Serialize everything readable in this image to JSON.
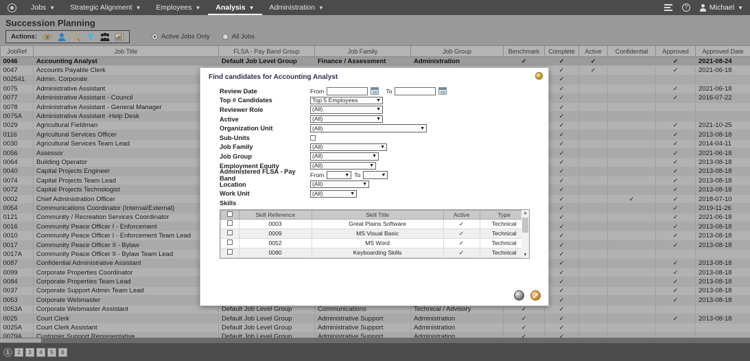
{
  "topnav": {
    "logo": "app-logo",
    "items": [
      {
        "label": "Jobs",
        "active": false
      },
      {
        "label": "Strategic Alignment",
        "active": false
      },
      {
        "label": "Employees",
        "active": false
      },
      {
        "label": "Analysis",
        "active": true
      },
      {
        "label": "Administration",
        "active": false
      }
    ],
    "user": "Michael"
  },
  "page": {
    "title": "Succession Planning",
    "actions_label": "Actions:",
    "action_icons": [
      "eye-icon",
      "person-icon",
      "magnifier-icon",
      "funnel-icon",
      "group-icon",
      "chart-icon"
    ],
    "radios": [
      {
        "label": "Active Jobs Only",
        "selected": true
      },
      {
        "label": "All Jobs",
        "selected": false
      }
    ]
  },
  "grid": {
    "columns": [
      "JobRef",
      "Job Title",
      "FLSA - Pay Band Group",
      "Job Family",
      "Job Group",
      "Benchmark",
      "Complete",
      "Active",
      "Confidential",
      "Approved",
      "Approved Date"
    ],
    "rows": [
      {
        "ref": "0046",
        "title": "Accounting Analyst",
        "flsa": "Default Job Level Group",
        "family": "Finance / Assessment",
        "group": "Administration",
        "benchmark": true,
        "complete": true,
        "active": true,
        "confidential": false,
        "approved": true,
        "date": "2021-08-24",
        "selected": true
      },
      {
        "ref": "0047",
        "title": "Accounts Payable Clerk",
        "flsa": "",
        "family": "",
        "group": "",
        "benchmark": true,
        "complete": true,
        "active": true,
        "confidential": false,
        "approved": true,
        "date": "2021-06-18"
      },
      {
        "ref": "002541",
        "title": "Admin. Corporate",
        "flsa": "",
        "family": "",
        "group": "",
        "benchmark": false,
        "complete": true,
        "active": false,
        "confidential": false,
        "approved": false,
        "date": ""
      },
      {
        "ref": "0075",
        "title": "Administrative Assistant",
        "flsa": "",
        "family": "",
        "group": "",
        "benchmark": true,
        "complete": true,
        "active": false,
        "confidential": false,
        "approved": true,
        "date": "2021-06-18"
      },
      {
        "ref": "0077",
        "title": "Administrative Assistant - Council",
        "flsa": "",
        "family": "",
        "group": "",
        "benchmark": true,
        "complete": true,
        "active": false,
        "confidential": false,
        "approved": true,
        "date": "2016-07-22"
      },
      {
        "ref": "0078",
        "title": "Administrative Assistant - General Manager",
        "flsa": "",
        "family": "",
        "group": "",
        "benchmark": true,
        "complete": true,
        "active": false,
        "confidential": false,
        "approved": false,
        "date": ""
      },
      {
        "ref": "0075A",
        "title": "Administrative Assistant -Help Desk",
        "flsa": "",
        "family": "",
        "group": "",
        "benchmark": true,
        "complete": true,
        "active": false,
        "confidential": false,
        "approved": false,
        "date": ""
      },
      {
        "ref": "0029",
        "title": "Agricultural Fieldman",
        "flsa": "",
        "family": "",
        "group": "",
        "benchmark": true,
        "complete": true,
        "active": false,
        "confidential": false,
        "approved": true,
        "date": "2021-10-25"
      },
      {
        "ref": "0116",
        "title": "Agricultural Services Officer",
        "flsa": "",
        "family": "",
        "group": "",
        "benchmark": true,
        "complete": true,
        "active": false,
        "confidential": false,
        "approved": true,
        "date": "2013-08-18"
      },
      {
        "ref": "0030",
        "title": "Agricultural Services Team Lead",
        "flsa": "",
        "family": "",
        "group": "",
        "benchmark": true,
        "complete": true,
        "active": false,
        "confidential": false,
        "approved": true,
        "date": "2014-04-11"
      },
      {
        "ref": "0056",
        "title": "Assessor",
        "flsa": "",
        "family": "",
        "group": "",
        "benchmark": true,
        "complete": true,
        "active": false,
        "confidential": false,
        "approved": true,
        "date": "2021-06-18"
      },
      {
        "ref": "0064",
        "title": "Building Operator",
        "flsa": "",
        "family": "",
        "group": "",
        "benchmark": true,
        "complete": true,
        "active": false,
        "confidential": false,
        "approved": true,
        "date": "2013-08-18"
      },
      {
        "ref": "0040",
        "title": "Capital Projects Engineer",
        "flsa": "",
        "family": "",
        "group": "",
        "benchmark": true,
        "complete": true,
        "active": false,
        "confidential": false,
        "approved": true,
        "date": "2013-08-18"
      },
      {
        "ref": "0074",
        "title": "Capital Projects Team Lead",
        "flsa": "",
        "family": "",
        "group": "",
        "benchmark": true,
        "complete": true,
        "active": false,
        "confidential": false,
        "approved": true,
        "date": "2013-08-18"
      },
      {
        "ref": "0072",
        "title": "Capital Projects Technologist",
        "flsa": "",
        "family": "",
        "group": "",
        "benchmark": true,
        "complete": true,
        "active": false,
        "confidential": false,
        "approved": true,
        "date": "2013-08-18"
      },
      {
        "ref": "0002",
        "title": "Chief Administration Officer",
        "flsa": "",
        "family": "",
        "group": "",
        "benchmark": true,
        "complete": true,
        "active": false,
        "confidential": true,
        "approved": true,
        "date": "2018-07-10"
      },
      {
        "ref": "0054",
        "title": "Communications Coordinator (Internal/External)",
        "flsa": "",
        "family": "",
        "group": "",
        "benchmark": true,
        "complete": true,
        "active": false,
        "confidential": false,
        "approved": true,
        "date": "2019-11-26"
      },
      {
        "ref": "0121",
        "title": "Community / Recreation Services Coordinator",
        "flsa": "",
        "family": "",
        "group": "",
        "benchmark": true,
        "complete": true,
        "active": false,
        "confidential": false,
        "approved": true,
        "date": "2021-06-18"
      },
      {
        "ref": "0016",
        "title": "Community Peace Officer I - Enforcement",
        "flsa": "",
        "family": "",
        "group": "",
        "benchmark": true,
        "complete": true,
        "active": false,
        "confidential": false,
        "approved": true,
        "date": "2013-08-18"
      },
      {
        "ref": "0010",
        "title": "Community Peace Officer I - Enforcement Team Lead",
        "flsa": "",
        "family": "",
        "group": "",
        "benchmark": true,
        "complete": true,
        "active": false,
        "confidential": false,
        "approved": true,
        "date": "2013-08-18"
      },
      {
        "ref": "0017",
        "title": "Community Peace Officer II - Bylaw",
        "flsa": "",
        "family": "",
        "group": "",
        "benchmark": true,
        "complete": true,
        "active": false,
        "confidential": false,
        "approved": true,
        "date": "2013-08-18"
      },
      {
        "ref": "0017A",
        "title": "Community Peace Officer II - Bylaw Team Lead",
        "flsa": "",
        "family": "",
        "group": "",
        "benchmark": true,
        "complete": true,
        "active": false,
        "confidential": false,
        "approved": false,
        "date": ""
      },
      {
        "ref": "0087",
        "title": "Confidential Administrative Assistant",
        "flsa": "",
        "family": "",
        "group": "",
        "benchmark": true,
        "complete": true,
        "active": false,
        "confidential": false,
        "approved": true,
        "date": "2013-08-18"
      },
      {
        "ref": "0099",
        "title": "Corporate Properties Coordinator",
        "flsa": "",
        "family": "",
        "group": "",
        "benchmark": true,
        "complete": true,
        "active": false,
        "confidential": false,
        "approved": true,
        "date": "2013-08-18"
      },
      {
        "ref": "0084",
        "title": "Corporate Properties Team Lead",
        "flsa": "",
        "family": "",
        "group": "",
        "benchmark": true,
        "complete": true,
        "active": false,
        "confidential": false,
        "approved": true,
        "date": "2013-08-18"
      },
      {
        "ref": "0037",
        "title": "Corporate Support Admin Team Lead",
        "flsa": "",
        "family": "",
        "group": "",
        "benchmark": true,
        "complete": true,
        "active": false,
        "confidential": false,
        "approved": true,
        "date": "2013-08-18"
      },
      {
        "ref": "0053",
        "title": "Corporate Webmaster",
        "flsa": "",
        "family": "",
        "group": "",
        "benchmark": true,
        "complete": true,
        "active": false,
        "confidential": false,
        "approved": true,
        "date": "2013-08-18"
      },
      {
        "ref": "0053A",
        "title": "Corporate Webmaster Assistant",
        "flsa": "Default Job Level Group",
        "family": "Communications",
        "group": "Technical / Advisory",
        "benchmark": true,
        "complete": true,
        "active": false,
        "confidential": false,
        "approved": false,
        "date": ""
      },
      {
        "ref": "0025",
        "title": "Court Clerk",
        "flsa": "Default Job Level Group",
        "family": "Administrative Support",
        "group": "Administration",
        "benchmark": true,
        "complete": true,
        "active": false,
        "confidential": false,
        "approved": true,
        "date": "2013-08-18"
      },
      {
        "ref": "0025A",
        "title": "Court Clerk Assistant",
        "flsa": "Default Job Level Group",
        "family": "Administrative Support",
        "group": "Administration",
        "benchmark": true,
        "complete": true,
        "active": false,
        "confidential": false,
        "approved": false,
        "date": ""
      },
      {
        "ref": "0079A",
        "title": "Customer Support Representative",
        "flsa": "Default Job Level Group",
        "family": "Administrative Support",
        "group": "Administration",
        "benchmark": true,
        "complete": true,
        "active": false,
        "confidential": false,
        "approved": false,
        "date": ""
      }
    ]
  },
  "modal": {
    "title": "Find candidates for Accounting Analyst",
    "close_icon": "close-icon",
    "fields": {
      "review_date": {
        "label": "Review Date",
        "from_label": "From",
        "to_label": "To",
        "from_value": "",
        "to_value": ""
      },
      "top_candidates": {
        "label": "Top # Candidates",
        "value": "Top 5 Employees"
      },
      "reviewer_role": {
        "label": "Reviewer Role",
        "value": "(All)"
      },
      "active": {
        "label": "Active",
        "value": "(All)"
      },
      "organization_unit": {
        "label": "Organization Unit",
        "value": "(All)"
      },
      "sub_units": {
        "label": "Sub-Units",
        "checked": false
      },
      "job_family": {
        "label": "Job Family",
        "value": "(All)"
      },
      "job_group": {
        "label": "Job Group",
        "value": "(All)"
      },
      "employment_equity": {
        "label": "Employment Equity",
        "value": "(All)"
      },
      "flsa_pay_band": {
        "label": "Administered FLSA - Pay Band",
        "from_label": "From",
        "to_label": "To",
        "from_value": "",
        "to_value": ""
      },
      "location": {
        "label": "Location",
        "value": "(All)"
      },
      "work_unit": {
        "label": "Work Unit",
        "value": "(All)"
      },
      "skills": {
        "label": "Skills"
      }
    },
    "skills_table": {
      "columns": [
        "",
        "Skill Reference",
        "Skill Title",
        "Active",
        "Type"
      ],
      "rows": [
        {
          "checked": false,
          "ref": "0003",
          "title": "Great Plains Software",
          "active": true,
          "type": "Technical"
        },
        {
          "checked": false,
          "ref": "0009",
          "title": "MS Visual Basic",
          "active": true,
          "type": "Technical"
        },
        {
          "checked": false,
          "ref": "0052",
          "title": "MS Word",
          "active": true,
          "type": "Technical"
        },
        {
          "checked": false,
          "ref": "0080",
          "title": "Keyboarding Skills",
          "active": true,
          "type": "Technical"
        }
      ]
    },
    "buttons": {
      "ok": "ok-button",
      "cancel": "cancel-button"
    }
  },
  "footer": {
    "pages": [
      "1",
      "2",
      "3",
      "4",
      "5",
      "6"
    ],
    "current_page": "1"
  },
  "symbols": {
    "check": "✓"
  }
}
